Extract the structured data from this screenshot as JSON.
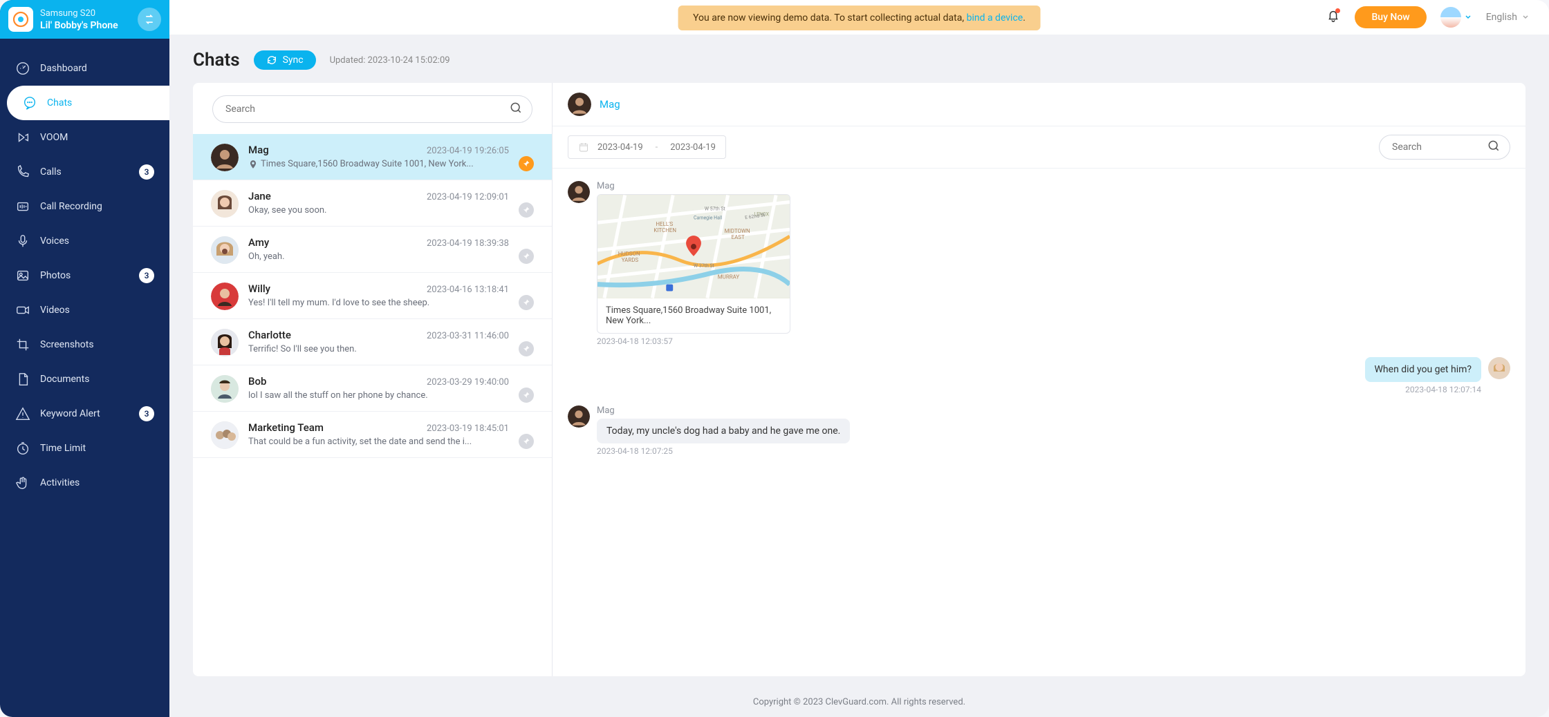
{
  "device": {
    "model": "Samsung S20",
    "name": "Lil' Bobby's Phone"
  },
  "topbar": {
    "demo_prefix": "You are now viewing demo data. To start collecting actual data, ",
    "demo_link": "bind a device",
    "demo_suffix": ".",
    "buy": "Buy Now",
    "language": "English"
  },
  "nav": {
    "dashboard": "Dashboard",
    "chats": "Chats",
    "voom": "VOOM",
    "calls": "Calls",
    "calls_badge": "3",
    "recording": "Call Recording",
    "voices": "Voices",
    "photos": "Photos",
    "photos_badge": "3",
    "videos": "Videos",
    "screenshots": "Screenshots",
    "documents": "Documents",
    "keyword": "Keyword Alert",
    "keyword_badge": "3",
    "timelimit": "Time Limit",
    "activities": "Activities"
  },
  "page": {
    "title": "Chats",
    "sync": "Sync",
    "updated": "Updated: 2023-10-24 15:02:09"
  },
  "search_placeholder": "Search",
  "chats": [
    {
      "name": "Mag",
      "time": "2023-04-19 19:26:05",
      "preview": "Times Square,1560 Broadway Suite 1001, New York...",
      "pinned": true,
      "hasLocation": true,
      "selected": true
    },
    {
      "name": "Jane",
      "time": "2023-04-19 12:09:01",
      "preview": "Okay, see you soon."
    },
    {
      "name": "Amy",
      "time": "2023-04-19 18:39:38",
      "preview": "Oh, yeah."
    },
    {
      "name": "Willy",
      "time": "2023-04-16 13:18:41",
      "preview": "Yes! I'll tell my mum. I'd love to see the sheep."
    },
    {
      "name": "Charlotte",
      "time": "2023-03-31 11:46:00",
      "preview": "Terrific! So I'll see you then."
    },
    {
      "name": "Bob",
      "time": "2023-03-29 19:40:00",
      "preview": "lol I saw all the stuff on her phone by chance."
    },
    {
      "name": "Marketing Team",
      "time": "2023-03-19 18:45:01",
      "preview": "That could be a fun activity, set the date and send the i..."
    }
  ],
  "conversation": {
    "name": "Mag",
    "date_from": "2023-04-19",
    "date_to": "2023-04-19",
    "messages": {
      "m1_sender": "Mag",
      "m1_location": "Times Square,1560 Broadway Suite 1001, New York...",
      "m1_time": "2023-04-18 12:03:57",
      "m2_text": "When did you get him?",
      "m2_time": "2023-04-18 12:07:14",
      "m3_sender": "Mag",
      "m3_text": "Today, my uncle's dog had a baby and he gave me one.",
      "m3_time": "2023-04-18 12:07:25"
    }
  },
  "footer": "Copyright © 2023 ClevGuard.com. All rights reserved."
}
